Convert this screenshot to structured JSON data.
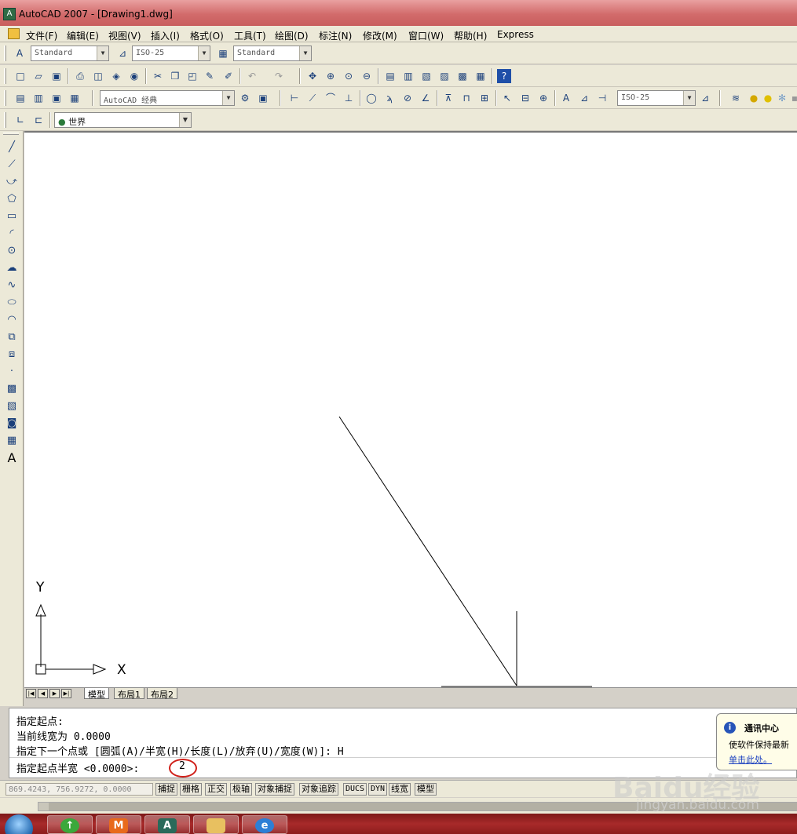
{
  "window": {
    "title": "AutoCAD 2007 - [Drawing1.dwg]"
  },
  "menu": [
    {
      "id": "file",
      "label": "文件(F)"
    },
    {
      "id": "edit",
      "label": "编辑(E)"
    },
    {
      "id": "view",
      "label": "视图(V)"
    },
    {
      "id": "insert",
      "label": "插入(I)"
    },
    {
      "id": "format",
      "label": "格式(O)"
    },
    {
      "id": "tools",
      "label": "工具(T)"
    },
    {
      "id": "draw",
      "label": "绘图(D)"
    },
    {
      "id": "dimension",
      "label": "标注(N)"
    },
    {
      "id": "modify",
      "label": "修改(M)"
    },
    {
      "id": "window",
      "label": "窗口(W)"
    },
    {
      "id": "help",
      "label": "帮助(H)"
    },
    {
      "id": "express",
      "label": "Express"
    }
  ],
  "styles_toolbar": {
    "text_style": "Standard",
    "dim_style": "ISO-25",
    "table_style": "Standard"
  },
  "workspace_toolbar": {
    "workspace": "AutoCAD 经典",
    "dim_style": "ISO-25"
  },
  "ucs_toolbar": {
    "ucs": "世界"
  },
  "canvas": {
    "x_label": "X",
    "y_label": "Y"
  },
  "layout_tabs": [
    {
      "id": "model",
      "label": "模型",
      "active": true
    },
    {
      "id": "layout1",
      "label": "布局1",
      "active": false
    },
    {
      "id": "layout2",
      "label": "布局2",
      "active": false
    }
  ],
  "command_line": {
    "history": [
      "指定起点:",
      "当前线宽为 0.0000",
      "指定下一个点或 [圆弧(A)/半宽(H)/长度(L)/放弃(U)/宽度(W)]: H"
    ],
    "prompt": "指定起点半宽 <0.0000>:",
    "input": "2"
  },
  "notification": {
    "title": "通讯中心",
    "body": "使软件保持最新",
    "link": "单击此处。"
  },
  "status_bar": {
    "coords": "869.4243, 756.9272, 0.0000",
    "toggles": [
      {
        "id": "snap",
        "label": "捕捉"
      },
      {
        "id": "grid",
        "label": "栅格"
      },
      {
        "id": "ortho",
        "label": "正交"
      },
      {
        "id": "polar",
        "label": "极轴"
      },
      {
        "id": "osnap",
        "label": "对象捕捉"
      },
      {
        "id": "otrack",
        "label": "对象追踪"
      },
      {
        "id": "ducs",
        "label": "DUCS"
      },
      {
        "id": "dyn",
        "label": "DYN"
      },
      {
        "id": "lwt",
        "label": "线宽"
      },
      {
        "id": "model",
        "label": "模型"
      }
    ]
  },
  "watermark": {
    "logo": "Baidu经验",
    "url": "jingyan.baidu.com"
  }
}
